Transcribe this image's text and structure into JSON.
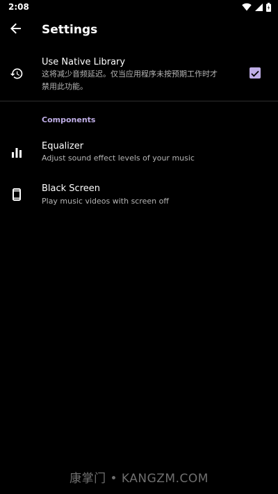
{
  "status_bar": {
    "time": "2:08",
    "icons": [
      "wifi-icon",
      "signal-icon",
      "battery-icon"
    ]
  },
  "app_bar": {
    "back_icon": "arrow-back-icon",
    "title": "Settings"
  },
  "preferences": {
    "native_library": {
      "icon": "history-icon",
      "title": "Use Native Library",
      "summary_line1": "这将减少音频延迟。仅当应用程序未按预期工作时才",
      "summary_line2": "禁用此功能。",
      "checked": true
    },
    "components_category": "Components",
    "equalizer": {
      "icon": "equalizer-icon",
      "title": "Equalizer",
      "summary": "Adjust sound effect levels of your music"
    },
    "black_screen": {
      "icon": "phone-icon",
      "title": "Black Screen",
      "summary": "Play music videos with screen off"
    }
  },
  "watermark": "康掌门 • KANGZM.COM",
  "colors": {
    "background": "#000000",
    "accent": "#bfaee6",
    "text_primary": "#ffffff",
    "text_secondary": "#b5b5b5"
  }
}
